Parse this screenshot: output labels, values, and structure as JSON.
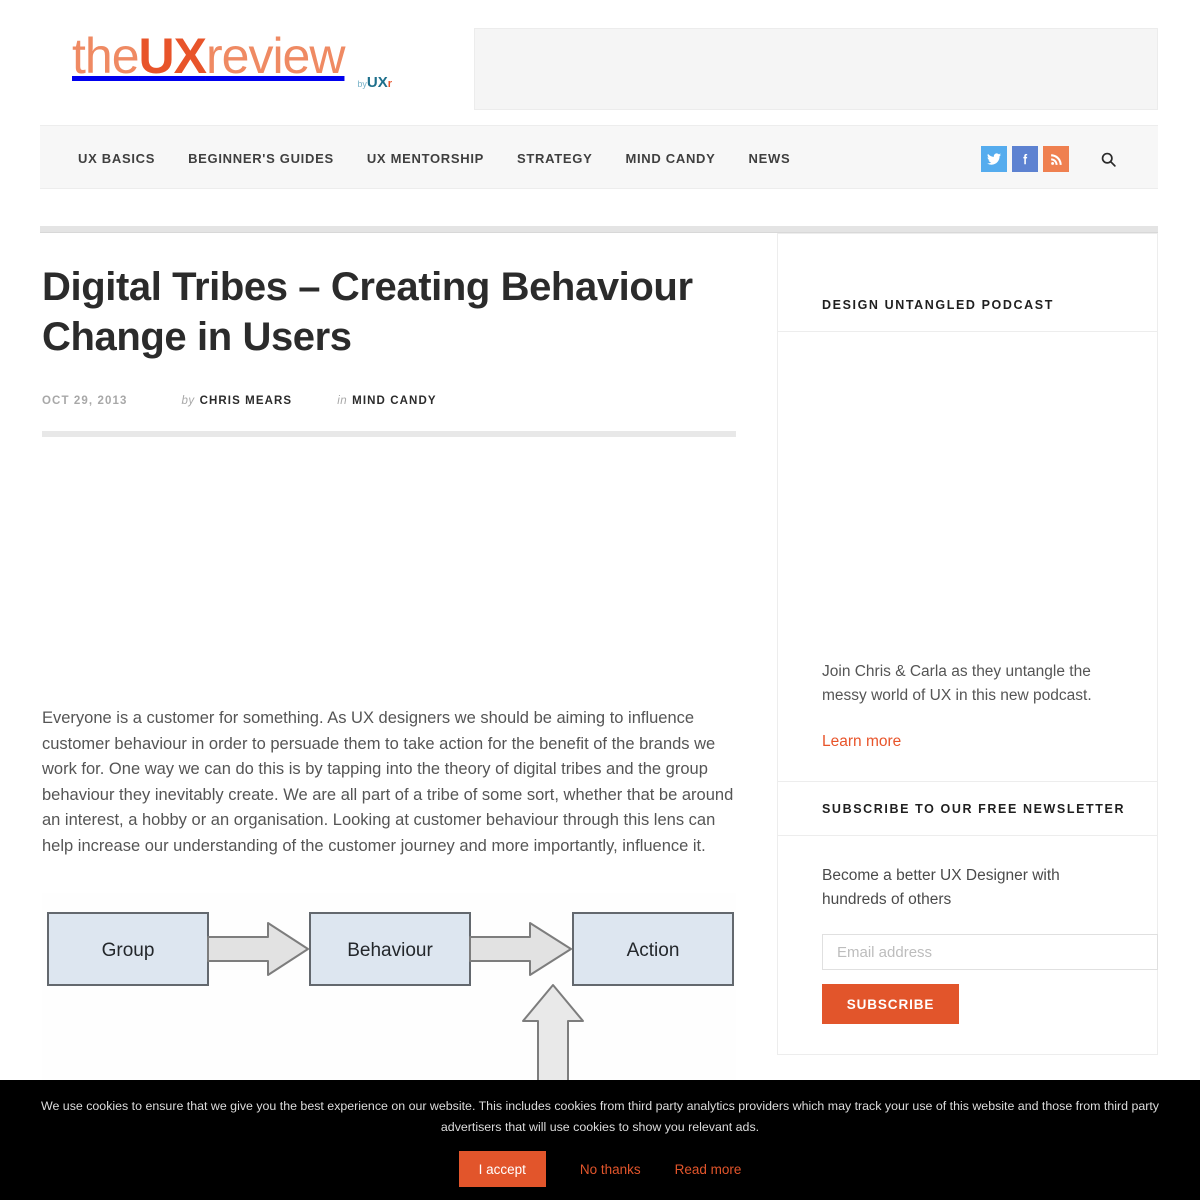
{
  "site": {
    "logo_part1": "the",
    "logo_part2": "UX",
    "logo_part3": "review",
    "logo_by": "by",
    "logo_brand": "UX",
    "logo_brand_r": "r"
  },
  "nav": {
    "items": [
      {
        "label": "UX BASICS"
      },
      {
        "label": "BEGINNER'S GUIDES"
      },
      {
        "label": "UX MENTORSHIP"
      },
      {
        "label": "STRATEGY"
      },
      {
        "label": "MIND CANDY"
      },
      {
        "label": "NEWS"
      }
    ],
    "social": [
      {
        "name": "twitter",
        "glyph": "🐦",
        "color": "#55acee"
      },
      {
        "name": "facebook",
        "glyph": "f",
        "color": "#5d82d1"
      },
      {
        "name": "rss",
        "glyph": "◜",
        "color": "#ef8050"
      }
    ],
    "search_label": "Search"
  },
  "post": {
    "title": "Digital Tribes – Creating Behaviour Change in Users",
    "date": "OCT 29, 2013",
    "by_word": "by",
    "author": "CHRIS MEARS",
    "in_word": "in",
    "category": "MIND CANDY",
    "paragraph": "Everyone is a customer for something. As UX designers we should be aiming to influence customer behaviour in order to persuade them to take action for the benefit of the brands we work for. One way we can do this is by tapping into the theory of digital tribes and the group behaviour they inevitably create. We are all part of a tribe of some sort, whether that be around an interest, a hobby or an organisation. Looking at customer behaviour through this lens can help increase our understanding of the customer journey and more importantly, influence it."
  },
  "diagram": {
    "boxes": [
      {
        "label": "Group"
      },
      {
        "label": "Behaviour"
      },
      {
        "label": "Action"
      }
    ],
    "box_fill": "#dde6f0",
    "box_stroke": "#63686e",
    "arrow_fill": "#e2e2e2",
    "arrow_stroke": "#7d7d7d"
  },
  "sidebar": {
    "podcast": {
      "heading": "DESIGN UNTANGLED PODCAST",
      "description": "Join Chris & Carla as they untangle the messy world of UX in this new podcast.",
      "link_label": "Learn more"
    },
    "newsletter": {
      "heading": "SUBSCRIBE TO OUR FREE NEWSLETTER",
      "description": "Become a better UX Designer with hundreds of others",
      "email_placeholder": "Email address",
      "email_value": "",
      "button_label": "SUBSCRIBE"
    }
  },
  "cookie": {
    "message": "We use cookies to ensure that we give you the best experience on our website. This includes cookies from third party analytics providers which may track your use of this website and those from third party advertisers that will use cookies to show you relevant ads.",
    "accept_label": "I accept",
    "decline_label": "No thanks",
    "readmore_label": "Read more",
    "accent": "#e2552b"
  }
}
